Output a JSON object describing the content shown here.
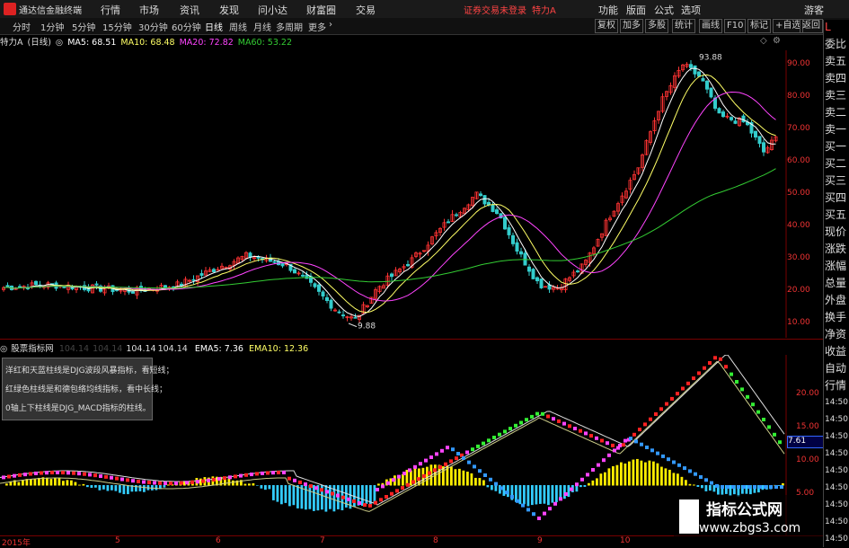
{
  "app": {
    "title": "通达信金融终端",
    "trade_warning": "证券交易未登录",
    "stock_header": "特力A"
  },
  "menu": [
    "行情",
    "市场",
    "资讯",
    "发现",
    "问小达",
    "财富圈",
    "交易"
  ],
  "menu_right": [
    "功能",
    "版面",
    "公式",
    "选项",
    "游客"
  ],
  "periods": [
    "分时",
    "1分钟",
    "5分钟",
    "15分钟",
    "30分钟",
    "60分钟",
    "日线",
    "周线",
    "月线",
    "多周期",
    "更多"
  ],
  "tools": [
    "复权",
    "加多",
    "多股",
    "统计",
    "画线",
    "F10",
    "标记",
    "+自选",
    "返回"
  ],
  "main_legend": {
    "name": "特力A",
    "period": "(日线)",
    "ma5": "MA5: 68.51",
    "ma10": "MA10: 68.48",
    "ma20": "MA20: 72.82",
    "ma60": "MA60: 53.22"
  },
  "price_ticks": [
    "90.00",
    "80.00",
    "70.00",
    "60.00",
    "50.00",
    "40.00",
    "30.00",
    "20.00",
    "10.00"
  ],
  "annotations": {
    "high": "93.88",
    "low": "9.88"
  },
  "ind_legend": {
    "name": "股票指标网",
    "v1": "104.14",
    "v2": "104.14",
    "v3": "104.14",
    "v4": "104.14",
    "ema5": "EMA5: 7.36",
    "ema10": "EMA10: 12.36"
  },
  "notes": [
    "洋红和天蓝柱线是DJG波段风暴指标，看短线；",
    "红绿色柱线是和德包络均线指标，看中长线；",
    "0轴上下柱线是DJG_MACD指标的柱线。"
  ],
  "ind_ticks": [
    "20.00",
    "15.00",
    "10.00",
    "5.00"
  ],
  "ind_value": "7.61",
  "time_ticks": [
    "2015年",
    "5",
    "6",
    "7",
    "8",
    "9",
    "10"
  ],
  "side": [
    "L",
    "委比",
    "卖五",
    "卖四",
    "卖三",
    "卖二",
    "卖一",
    "买一",
    "买二",
    "买三",
    "买四",
    "买五",
    "现价",
    "涨跌",
    "涨幅",
    "总量",
    "外盘",
    "换手",
    "净资",
    "收益",
    "自动",
    "行情",
    "14:50",
    "14:50",
    "14:50",
    "14:50",
    "14:50",
    "14:50",
    "14:50",
    "14:50",
    "14:50"
  ],
  "watermark": {
    "line1": "指标公式网",
    "line2": "www.zbgs3.com"
  },
  "colors": {
    "up": "#ff3333",
    "down": "#33cccc",
    "ma5": "#ffffff",
    "ma10": "#ffff66",
    "ma20": "#ff44ff",
    "ma60": "#33cc33"
  }
}
